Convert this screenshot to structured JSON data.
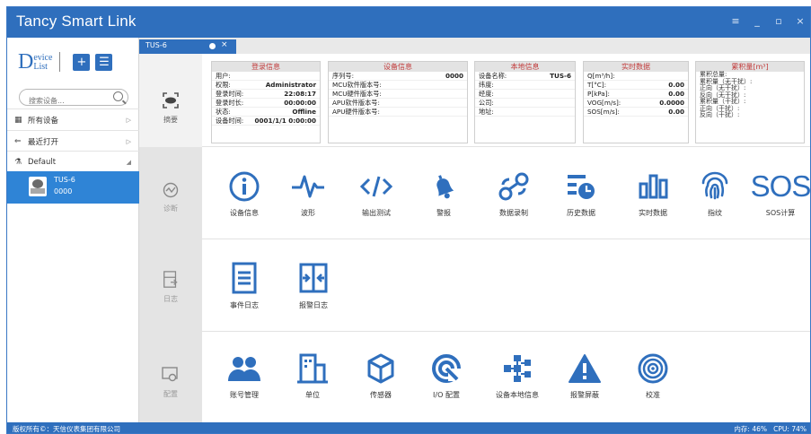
{
  "app": {
    "title": "Tancy Smart Link",
    "window_controls": [
      "≡",
      "_",
      "▫",
      "×"
    ]
  },
  "sidebar": {
    "logo_main": "D",
    "logo_top": "evice",
    "logo_bottom": "List",
    "search_placeholder": "搜索设备...",
    "nav": [
      {
        "icon": "▦",
        "label": "所有设备",
        "arrow": "▷"
      },
      {
        "icon": "⇐",
        "label": "最近打开",
        "arrow": "▷"
      },
      {
        "icon": "⚗",
        "label": "Default",
        "arrow": "◢"
      }
    ],
    "device": {
      "name": "TUS-6",
      "serial": "0000"
    }
  },
  "tab": {
    "label": "TUS-6"
  },
  "rail": [
    {
      "label": "摘要"
    },
    {
      "label": "诊断"
    },
    {
      "label": "日志"
    },
    {
      "label": "配置"
    }
  ],
  "summary": {
    "login": {
      "title": "登录信息",
      "rows": [
        {
          "k": "用户:",
          "v": ""
        },
        {
          "k": "权限:",
          "v": "Administrator"
        },
        {
          "k": "登录时间:",
          "v": "22:08:17"
        },
        {
          "k": "登录时长:",
          "v": "00:00:00"
        },
        {
          "k": "状态:",
          "v": "Offline"
        },
        {
          "k": "设备时间:",
          "v": "0001/1/1 0:00:00"
        }
      ]
    },
    "device": {
      "title": "设备信息",
      "rows": [
        {
          "k": "序列号:",
          "v": "0000"
        },
        {
          "k": "MCU软件版本号:",
          "v": ""
        },
        {
          "k": "MCU硬件版本号:",
          "v": ""
        },
        {
          "k": "APU软件版本号:",
          "v": ""
        },
        {
          "k": "APU硬件版本号:",
          "v": ""
        }
      ]
    },
    "local": {
      "title": "本地信息",
      "rows": [
        {
          "k": "设备名称:",
          "v": "TUS-6"
        },
        {
          "k": "纬度:",
          "v": ""
        },
        {
          "k": "经度:",
          "v": ""
        },
        {
          "k": "公司:",
          "v": ""
        },
        {
          "k": "地址:",
          "v": ""
        }
      ]
    },
    "realtime": {
      "title": "实时数据",
      "rows": [
        {
          "k": "Q[m³/h]:",
          "v": ""
        },
        {
          "k": "T[°C]:",
          "v": "0.00"
        },
        {
          "k": "P[kPa]:",
          "v": "0.00"
        },
        {
          "k": "VOG[m/s]:",
          "v": "0.0000"
        },
        {
          "k": "SOS[m/s]:",
          "v": "0.00"
        }
      ]
    },
    "cumulative": {
      "title": "累积量[m³]",
      "rows": [
        "累积总量:",
        "累积量（无干扰）:",
        "正向（无干扰）:",
        "反向（无干扰）:",
        "累积量（干扰）:",
        "正向（干扰）:",
        "反向（干扰）:"
      ]
    }
  },
  "diagnosis": [
    {
      "icon": "info-icon",
      "label": "设备信息"
    },
    {
      "icon": "waveform-icon",
      "label": "波形"
    },
    {
      "icon": "code-icon",
      "label": "输出测试"
    },
    {
      "icon": "bell-icon",
      "label": "警报"
    },
    {
      "icon": "link-icon",
      "label": "数据录制"
    },
    {
      "icon": "history-icon",
      "label": "历史数据"
    },
    {
      "icon": "bar-chart-icon",
      "label": "实时数据"
    },
    {
      "icon": "fingerprint-icon",
      "label": "指纹"
    },
    {
      "icon": "sos-icon",
      "label": "SOS计算",
      "glyph": "SOS"
    }
  ],
  "logs": [
    {
      "icon": "document-icon",
      "label": "事件日志"
    },
    {
      "icon": "alarm-log-icon",
      "label": "报警日志"
    }
  ],
  "config": [
    {
      "icon": "users-icon",
      "label": "账号管理"
    },
    {
      "icon": "building-icon",
      "label": "单位"
    },
    {
      "icon": "cube-icon",
      "label": "传感器"
    },
    {
      "icon": "io-icon",
      "label": "I/O 配置"
    },
    {
      "icon": "network-icon",
      "label": "设备本地信息"
    },
    {
      "icon": "warning-icon",
      "label": "报警屏蔽"
    },
    {
      "icon": "target-icon",
      "label": "校准"
    }
  ],
  "status": {
    "copyright": "版权所有©：天信仪表集团有限公司",
    "memory": "内存: 46%",
    "cpu": "CPU: 74%"
  },
  "colors": {
    "accent": "#2f6fbd",
    "header_text": "#c23b3b"
  }
}
